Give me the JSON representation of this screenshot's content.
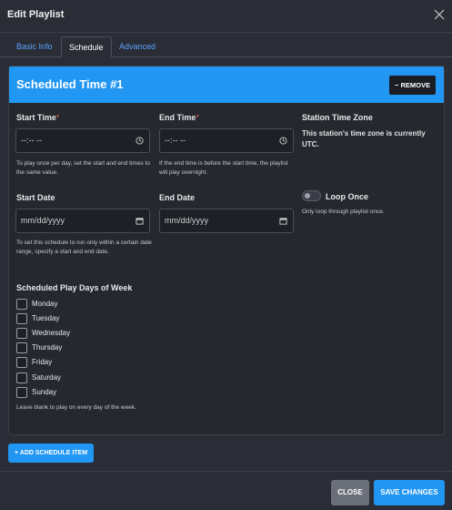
{
  "modal": {
    "title": "Edit Playlist"
  },
  "tabs": [
    {
      "label": "Basic Info"
    },
    {
      "label": "Schedule"
    },
    {
      "label": "Advanced"
    }
  ],
  "schedule_item": {
    "title": "Scheduled Time #1",
    "remove_label": "− REMOVE",
    "start_time": {
      "label": "Start Time",
      "required_mark": "*",
      "value": "--:-- --",
      "help": "To play once per day, set the start and end times to the same value."
    },
    "end_time": {
      "label": "End Time",
      "required_mark": "*",
      "value": "--:-- --",
      "help": "If the end time is before the start time, the playlist will play overnight."
    },
    "timezone": {
      "label": "Station Time Zone",
      "text": "This station's time zone is currently UTC."
    },
    "start_date": {
      "label": "Start Date",
      "value": "mm/dd/yyyy",
      "help": "To set this schedule to run only within a certain date range, specify a start and end date."
    },
    "end_date": {
      "label": "End Date",
      "value": "mm/dd/yyyy"
    },
    "loop_once": {
      "label": "Loop Once",
      "help": "Only loop through playlist once.",
      "checked": false
    },
    "days": {
      "label": "Scheduled Play Days of Week",
      "items": [
        "Monday",
        "Tuesday",
        "Wednesday",
        "Thursday",
        "Friday",
        "Saturday",
        "Sunday"
      ],
      "help": "Leave blank to play on every day of the week."
    }
  },
  "add_schedule_label": "+ ADD SCHEDULE ITEM",
  "footer": {
    "close_label": "CLOSE",
    "save_label": "SAVE CHANGES"
  },
  "colors": {
    "accent": "#2196f3",
    "background": "#2b2d36",
    "card": "#262830"
  }
}
